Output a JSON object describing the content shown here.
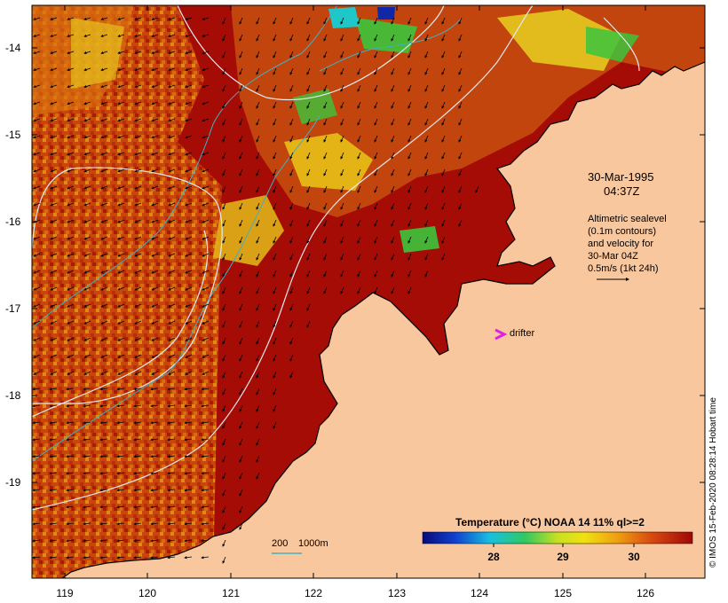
{
  "map": {
    "y_axis_labels": [
      "-14",
      "-15",
      "-16",
      "-17",
      "-18",
      "-19"
    ],
    "x_axis_labels": [
      "119",
      "120",
      "121",
      "122",
      "123",
      "124",
      "125",
      "126"
    ],
    "datetime": "30-Mar-1995",
    "time": "04:37Z",
    "info_lines": [
      "Altimetric sealevel",
      "(0.1m contours)",
      "and velocity for",
      "30-Mar 04Z",
      "0.5m/s (1kt 24h)"
    ],
    "drifter_label": "drifter",
    "drifter_symbol": ">",
    "depth_label_1": "200",
    "depth_label_2": "1000m",
    "colorbar_title": "Temperature (°C) NOAA 14 11% ql>=2",
    "colorbar_ticks": [
      "28",
      "29",
      "30"
    ],
    "credit": "© IMOS 15-Feb-2020 08:28:14 Hobart time",
    "colors": {
      "land": "#f9c79d",
      "hot_sst": "#a50c05",
      "warm_sst": "#d9520e",
      "mid_sst": "#e8a010",
      "yellow_sst": "#f4e41a",
      "green_sst": "#3cc43c",
      "cyan_sst": "#1ec8c8",
      "blue_sst": "#1028a8",
      "drifter": "#e020e0",
      "contour": "#e8e8f0",
      "isobath": "#40b0c0"
    }
  }
}
